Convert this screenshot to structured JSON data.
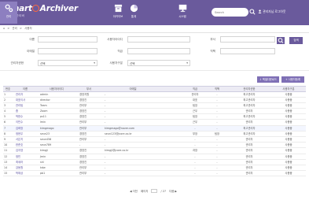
{
  "app": {
    "logo_main": "Smart",
    "logo_tail": "Archiver",
    "logo_sub": "스마트아카이버"
  },
  "nav": [
    {
      "label": "아카이브",
      "icon": "archive-box-icon"
    },
    {
      "label": "통계",
      "icon": "pie-chart-icon"
    },
    {
      "label": "관리",
      "icon": "gears-icon"
    },
    {
      "label": "시스템",
      "icon": "monitor-icon"
    }
  ],
  "header": {
    "search_placeholder": "Search",
    "user_text": "관리자님 로그아웃"
  },
  "breadcrumb": [
    "⌂",
    ">",
    "관리",
    ">",
    "사용자"
  ],
  "filters": {
    "row1": [
      {
        "label": "이름",
        "value": ""
      },
      {
        "label": "사용자아이디",
        "value": ""
      },
      {
        "label": "부서",
        "value": ""
      }
    ],
    "row2": [
      {
        "label": "이메일",
        "value": ""
      },
      {
        "label": "직급",
        "value": ""
      },
      {
        "label": "직책",
        "value": ""
      }
    ],
    "row3": [
      {
        "label": "관리자권한",
        "value": "선택"
      },
      {
        "label": "사용자구분",
        "value": "선택"
      }
    ],
    "search_button": "검색"
  },
  "actions": {
    "excel": "엑셀다운로드",
    "add": "사용자등록"
  },
  "table": {
    "headers": [
      "번호",
      "이름",
      "사용자아이디",
      "부서",
      "이메일",
      "직급",
      "직책",
      "관리자권한",
      "사용자구분"
    ],
    "rows": [
      [
        "1",
        "관리자",
        "admin",
        "경영지원",
        "-",
        "관리자",
        "-",
        "최고관리자",
        "사용중"
      ],
      [
        "2",
        "대표이사",
        "director",
        "경영진",
        "-",
        "대표",
        "-",
        "최고관리자",
        "사용중"
      ],
      [
        "3",
        "관리팀",
        "Team",
        "관리부",
        "-",
        "팀장",
        "-",
        "최고관리자",
        "사용중"
      ],
      [
        "4",
        "줌",
        "Zoom",
        "경영진",
        "-",
        "근무",
        "-",
        "관리자",
        "사용중"
      ],
      [
        "5",
        "박현수",
        "ps11",
        "경영진",
        "-",
        "팀장",
        "-",
        "최고관리자",
        "사용중"
      ],
      [
        "6",
        "이민수",
        "lmin",
        "관리부",
        "-",
        "근무",
        "-",
        "관리자",
        "사용중"
      ],
      [
        "7",
        "김희망",
        "kimgmago",
        "관리부",
        "kimgmago@naver.com",
        "-",
        "-",
        "최고관리자",
        "사용중"
      ],
      [
        "8",
        "정현우",
        "seun23",
        "경영진",
        "seun123@jcore.co.kr",
        "부장",
        "팀장",
        "최고관리자",
        "사용중"
      ],
      [
        "9",
        "서은지",
        "seun456",
        "관리부",
        "-",
        "-",
        "-",
        "관리자",
        "사용중"
      ],
      [
        "10",
        "한준호",
        "seun789",
        "-",
        "-",
        "-",
        "-",
        "관리자",
        "사용중"
      ],
      [
        "11",
        "김지영",
        "kimgji",
        "경영진",
        "kimgji@jcore.co.kr",
        "과장",
        "-",
        "관리자",
        "사용중"
      ],
      [
        "12",
        "정민",
        "Jmin",
        "경영진",
        "-",
        "-",
        "-",
        "관리자",
        "사용중"
      ],
      [
        "13",
        "최세라",
        "shl",
        "경영진",
        "-",
        "-",
        "-",
        "관리자",
        "사용중"
      ],
      [
        "14",
        "강동원",
        "kdw",
        "관리부",
        "-",
        "-",
        "-",
        "관리자",
        "사용중"
      ],
      [
        "15",
        "박제상",
        "pb1",
        "관리부",
        "-",
        "-",
        "-",
        "관리자",
        "사용중"
      ]
    ]
  },
  "pager": {
    "prev": "◀ 이전",
    "page_label": "페이지",
    "of": "/ 27",
    "next": "다음 ▶"
  }
}
